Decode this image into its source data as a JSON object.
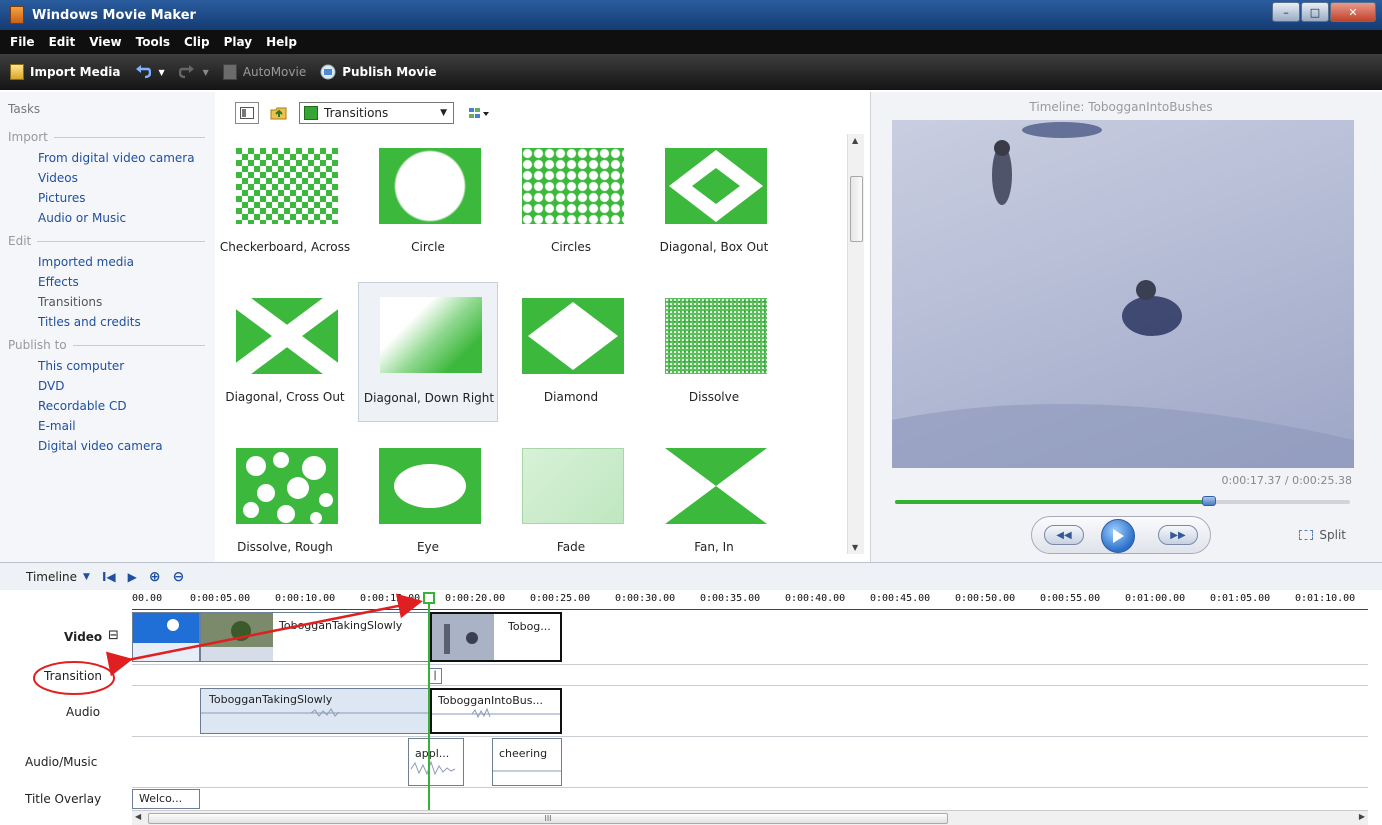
{
  "window": {
    "title": "Windows Movie Maker",
    "min_glyph": "–",
    "max_glyph": "□",
    "close_glyph": "✕"
  },
  "menu": [
    "File",
    "Edit",
    "View",
    "Tools",
    "Clip",
    "Play",
    "Help"
  ],
  "toolbar": {
    "import_label": "Import Media",
    "automovie_label": "AutoMovie",
    "publish_label": "Publish Movie"
  },
  "tasks": {
    "header": "Tasks",
    "groups": [
      {
        "title": "Import",
        "links": [
          {
            "label": "From digital video camera",
            "disabled": false
          },
          {
            "label": "Videos",
            "disabled": false
          },
          {
            "label": "Pictures",
            "disabled": false
          },
          {
            "label": "Audio or Music",
            "disabled": false
          }
        ]
      },
      {
        "title": "Edit",
        "links": [
          {
            "label": "Imported media",
            "disabled": false
          },
          {
            "label": "Effects",
            "disabled": false
          },
          {
            "label": "Transitions",
            "disabled": true
          },
          {
            "label": "Titles and credits",
            "disabled": false
          }
        ]
      },
      {
        "title": "Publish to",
        "links": [
          {
            "label": "This computer",
            "disabled": false
          },
          {
            "label": "DVD",
            "disabled": false
          },
          {
            "label": "Recordable CD",
            "disabled": false
          },
          {
            "label": "E-mail",
            "disabled": false
          },
          {
            "label": "Digital video camera",
            "disabled": false
          }
        ]
      }
    ]
  },
  "content": {
    "view_dropdown": "Transitions",
    "items": [
      {
        "label": "Checkerboard, Across",
        "icon": "checkerboard-icon"
      },
      {
        "label": "Circle",
        "icon": "circle-icon"
      },
      {
        "label": "Circles",
        "icon": "circles-icon"
      },
      {
        "label": "Diagonal, Box Out",
        "icon": "diagonal-box-out-icon"
      },
      {
        "label": "Diagonal, Cross Out",
        "icon": "diagonal-cross-out-icon"
      },
      {
        "label": "Diagonal, Down Right",
        "icon": "diagonal-down-right-icon"
      },
      {
        "label": "Diamond",
        "icon": "diamond-icon"
      },
      {
        "label": "Dissolve",
        "icon": "dissolve-icon"
      },
      {
        "label": "Dissolve, Rough",
        "icon": "dissolve-rough-icon"
      },
      {
        "label": "Eye",
        "icon": "eye-icon"
      },
      {
        "label": "Fade",
        "icon": "fade-icon"
      },
      {
        "label": "Fan, In",
        "icon": "fan-in-icon"
      }
    ],
    "selected_item": "Diagonal, Down Right"
  },
  "preview": {
    "title": "Timeline: TobogganIntoBushes",
    "time": "0:00:17.37 / 0:00:25.38",
    "progress": 0.69,
    "split_label": "Split"
  },
  "timeline": {
    "header_label": "Timeline",
    "ruler": [
      "00.00",
      "0:00:05.00",
      "0:00:10.00",
      "0:00:15.00",
      "0:00:20.00",
      "0:00:25.00",
      "0:00:30.00",
      "0:00:35.00",
      "0:00:40.00",
      "0:00:45.00",
      "0:00:50.00",
      "0:00:55.00",
      "0:01:00.00",
      "0:01:05.00",
      "0:01:10.00"
    ],
    "tracks": {
      "video": "Video",
      "transition": "Transition",
      "audio": "Audio",
      "audio_music": "Audio/Music",
      "title_overlay": "Title Overlay"
    },
    "collapse_glyph": "⊟",
    "video_clips": [
      "TobogganTakingSlowly",
      "Tobog..."
    ],
    "transition_marker": "|",
    "audio_clips": [
      "TobogganTakingSlowly",
      "TobogganIntoBus..."
    ],
    "music_clips": [
      "appl...",
      "cheering"
    ],
    "title_clips": [
      "Welco..."
    ]
  },
  "scroll_glyph": "III",
  "colors": {
    "transition_green": "#3cb83c",
    "link_blue": "#1f4f9f",
    "annotation_red": "#e02020"
  }
}
